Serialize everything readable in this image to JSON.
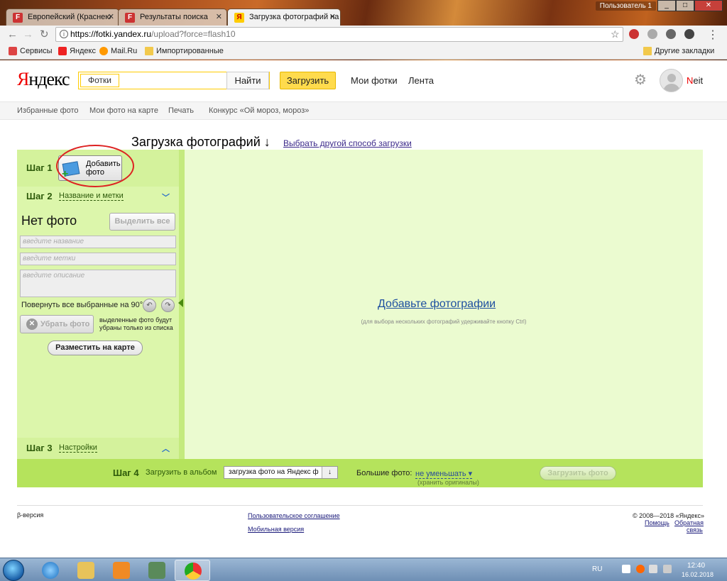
{
  "browser": {
    "tabs": [
      {
        "title": "Европейский (Краснею",
        "favicon": "f-icon"
      },
      {
        "title": "Результаты поиска",
        "favicon": "f-icon"
      },
      {
        "title": "Загрузка фотографий на",
        "favicon": "yandex-icon"
      }
    ],
    "user_label": "Пользователь 1",
    "url_host": "https://fotki.yandex.ru",
    "url_path": "/upload?force=flash10",
    "bookmarks": [
      {
        "label": "Сервисы"
      },
      {
        "label": "Яндекс"
      },
      {
        "label": "Mail.Ru"
      },
      {
        "label": "Импортированные"
      }
    ],
    "other_bookmarks": "Другие закладки"
  },
  "header": {
    "logo_red": "Я",
    "logo_rest": "ндекс",
    "search_tag": "Фотки",
    "search_value": "",
    "search_button": "Найти",
    "upload_button": "Загрузить",
    "links": [
      "Мои фотки",
      "Лента"
    ],
    "user_first": "N",
    "user_rest": "eit"
  },
  "subnav": [
    "Избранные фото",
    "Мои фото на карте",
    "Печать",
    "Конкурс «Ой мороз, мороз»"
  ],
  "upload": {
    "title": "Загрузка фотографий ↓",
    "other_way": "Выбрать другой способ загрузки",
    "step1": {
      "label": "Шаг 1",
      "button": "Добавить фото"
    },
    "step2": {
      "label": "Шаг 2",
      "sub": "Название и метки",
      "no_photo": "Нет фото",
      "select_all": "Выделить все",
      "name_placeholder": "введите название",
      "tags_placeholder": "введите метки",
      "desc_placeholder": "введите описание",
      "rotate_label": "Повернуть все выбранные на 90°",
      "remove_button": "Убрать фото",
      "remove_note": "выделенные фото будут убраны только из списка",
      "map_button": "Разместить на карте"
    },
    "step3": {
      "label": "Шаг 3",
      "sub": "Настройки"
    },
    "drop": {
      "link": "Добавьте фотографии",
      "hint": "(для выбора нескольких фотографий удерживайте кнопку Ctrl)"
    },
    "step4": {
      "label": "Шаг 4",
      "sub": "Загрузить в альбом",
      "album": "загрузка фото на Яндекс ф",
      "big_label": "Большие фото:",
      "big_value": "не уменьшать ▾",
      "big_note": "(хранить оригиналы)",
      "upload_button": "Загрузить фото"
    }
  },
  "footer": {
    "beta": "β-версия",
    "agreement": "Пользовательское соглашение",
    "mobile": "Мобильная версия",
    "copyright": "© 2008—2018 «Яндекс»",
    "help": "Помощь",
    "feedback1": "Обратная",
    "feedback2": "связь"
  },
  "taskbar": {
    "lang": "RU",
    "time": "12:40",
    "date": "16.02.2018"
  }
}
